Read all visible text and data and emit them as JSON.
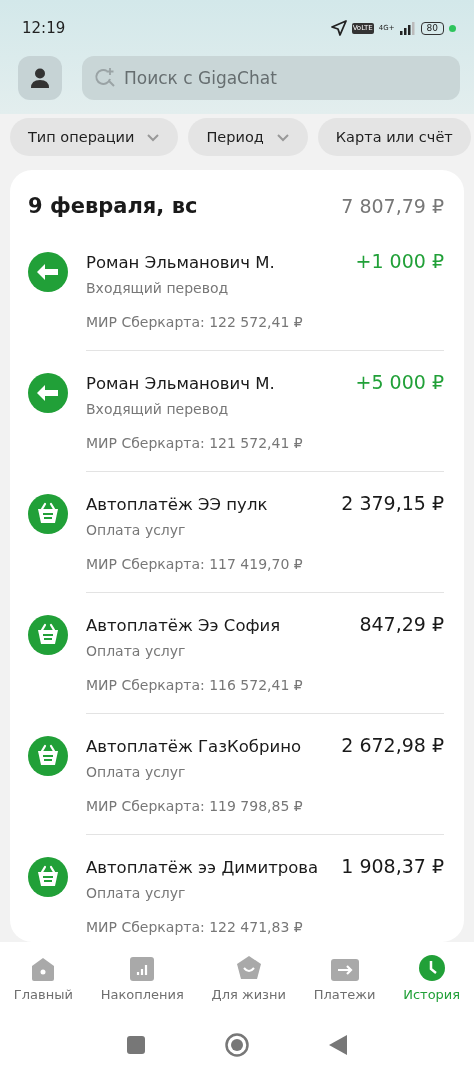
{
  "status_bar": {
    "time": "12:19",
    "volte": "VoLTE",
    "network": "4G+",
    "battery": "80"
  },
  "search": {
    "placeholder": "Поиск с GigaChat"
  },
  "filters": [
    {
      "label": "Тип операции",
      "dropdown": true
    },
    {
      "label": "Период",
      "dropdown": true
    },
    {
      "label": "Карта или счёт",
      "dropdown": false
    }
  ],
  "day": {
    "date": "9 февраля, вс",
    "total": "7 807,79 ₽"
  },
  "transactions": [
    {
      "kind": "incoming",
      "title": "Роман Эльманович М.",
      "subtitle": "Входящий перевод",
      "account": "МИР Сберкарта: 122 572,41 ₽",
      "amount": "+1 000 ₽"
    },
    {
      "kind": "incoming",
      "title": "Роман Эльманович М.",
      "subtitle": "Входящий перевод",
      "account": "МИР Сберкарта: 121 572,41 ₽",
      "amount": "+5 000 ₽"
    },
    {
      "kind": "payment",
      "title": "Автоплатёж ЭЭ пулк",
      "subtitle": "Оплата услуг",
      "account": "МИР Сберкарта: 117 419,70 ₽",
      "amount": "2 379,15 ₽"
    },
    {
      "kind": "payment",
      "title": "Автоплатёж Ээ София",
      "subtitle": "Оплата услуг",
      "account": "МИР Сберкарта: 116 572,41 ₽",
      "amount": "847,29 ₽"
    },
    {
      "kind": "payment",
      "title": "Автоплатёж ГазКобрино",
      "subtitle": "Оплата услуг",
      "account": "МИР Сберкарта: 119 798,85 ₽",
      "amount": "2 672,98 ₽"
    },
    {
      "kind": "payment",
      "title": "Автоплатёж ээ Димитрова",
      "subtitle": "Оплата услуг",
      "account": "МИР Сберкарта: 122 471,83 ₽",
      "amount": "1 908,37 ₽"
    }
  ],
  "bottom_nav": [
    {
      "kind": "home",
      "label": "Главный",
      "selected": false
    },
    {
      "kind": "savings",
      "label": "Накопления",
      "selected": false
    },
    {
      "kind": "life",
      "label": "Для жизни",
      "selected": false
    },
    {
      "kind": "payments",
      "label": "Платежи",
      "selected": false
    },
    {
      "kind": "history",
      "label": "История",
      "selected": true
    }
  ]
}
